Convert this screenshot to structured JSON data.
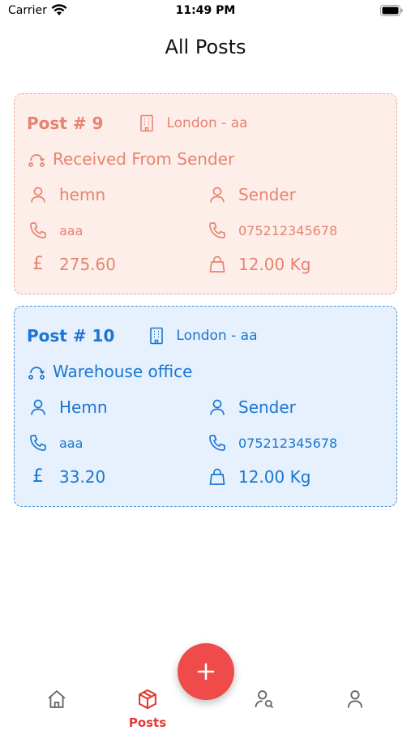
{
  "status_bar": {
    "carrier": "Carrier",
    "time": "11:49 PM"
  },
  "page": {
    "title": "All Posts"
  },
  "posts": [
    {
      "number": "Post # 9",
      "location": "London - aa",
      "status": "Received From Sender",
      "receiver_name": "hemn",
      "sender_name": "Sender",
      "receiver_phone": "aaa",
      "sender_phone": "075212345678",
      "price": "275.60",
      "weight": "12.00 Kg",
      "theme_color": "#e8836f"
    },
    {
      "number": "Post # 10",
      "location": "London - aa",
      "status": "Warehouse office",
      "receiver_name": "Hemn",
      "sender_name": "Sender",
      "receiver_phone": "aaa",
      "sender_phone": "075212345678",
      "price": "33.20",
      "weight": "12.00 Kg",
      "theme_color": "#1976d2"
    }
  ],
  "nav": {
    "items": [
      {
        "icon": "home-icon"
      },
      {
        "icon": "package-icon",
        "label": "Posts",
        "active": true
      },
      {
        "icon": "user-search-icon"
      },
      {
        "icon": "user-icon"
      }
    ],
    "fab_icon": "plus-icon",
    "accent": "#e53935"
  }
}
